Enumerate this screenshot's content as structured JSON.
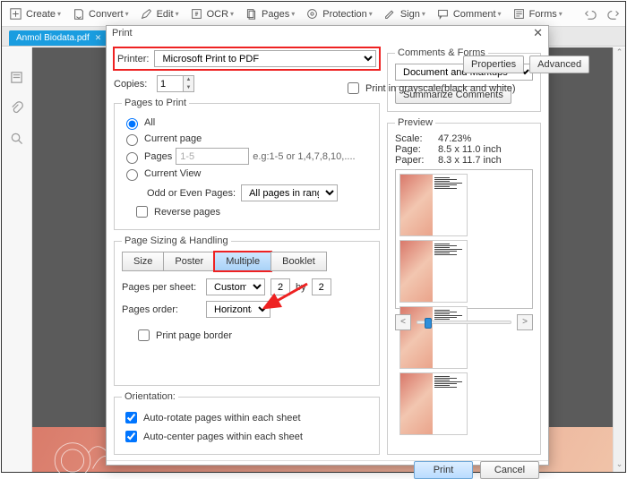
{
  "toolbar": {
    "create": "Create",
    "convert": "Convert",
    "edit": "Edit",
    "ocr": "OCR",
    "pages": "Pages",
    "protection": "Protection",
    "sign": "Sign",
    "comment": "Comment",
    "forms": "Forms"
  },
  "tab": {
    "name": "Anmol Biodata.pdf"
  },
  "dialog": {
    "title": "Print",
    "printer_label": "Printer:",
    "printer_value": "Microsoft Print to PDF",
    "properties": "Properties",
    "advanced": "Advanced",
    "copies_label": "Copies:",
    "copies_value": "1",
    "grayscale": "Print in grayscale(black and white)",
    "pages_to_print": {
      "legend": "Pages to Print",
      "all": "All",
      "current_page": "Current page",
      "pages": "Pages",
      "pages_value": "1-5",
      "pages_hint": "e.g:1-5 or 1,4,7,8,10,....",
      "current_view": "Current View",
      "odd_even_label": "Odd or Even Pages:",
      "odd_even_value": "All pages in range",
      "reverse": "Reverse pages"
    },
    "sizing": {
      "legend": "Page Sizing & Handling",
      "size": "Size",
      "poster": "Poster",
      "multiple": "Multiple",
      "booklet": "Booklet",
      "pps_label": "Pages per sheet:",
      "pps_mode": "Custom Sc",
      "pps_w": "2",
      "pps_by": "by",
      "pps_h": "2",
      "order_label": "Pages order:",
      "order_value": "Horizontal",
      "border": "Print page border"
    },
    "orientation": {
      "legend": "Orientation:",
      "auto_rotate": "Auto-rotate pages within each sheet",
      "auto_center": "Auto-center pages within each sheet"
    },
    "comments": {
      "legend": "Comments & Forms",
      "value": "Document and Markups",
      "summarize": "Summarize Comments"
    },
    "preview": {
      "legend": "Preview",
      "scale_label": "Scale:",
      "scale_value": "47.23%",
      "page_label": "Page:",
      "page_value": "8.5 x 11.0 inch",
      "paper_label": "Paper:",
      "paper_value": "8.3 x 11.7 inch"
    },
    "nav_prev": "<",
    "nav_next": ">",
    "print_btn": "Print",
    "cancel_btn": "Cancel"
  }
}
